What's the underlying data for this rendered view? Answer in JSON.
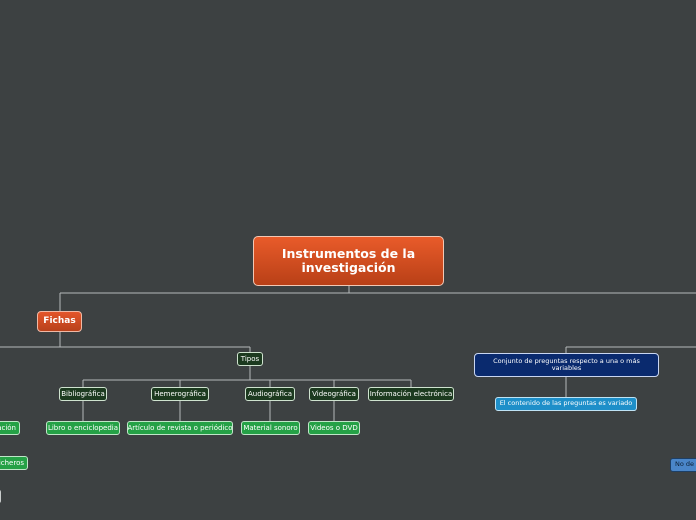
{
  "root": {
    "title": "Instrumentos de la investigación"
  },
  "fichas": {
    "label": "Fichas"
  },
  "tipos": {
    "label": "Tipos"
  },
  "categories": [
    {
      "label": "Bibliográfica",
      "example": "Libro o enciclopedia"
    },
    {
      "label": "Hemerográfica",
      "example": "Artículo de revista o periódico"
    },
    {
      "label": "Audiográfica",
      "example": "Material sonoro"
    },
    {
      "label": "Videográfica",
      "example": "Videos o DVD"
    },
    {
      "label": "Información electrónica"
    }
  ],
  "left_partial": [
    "ación",
    "ficheros"
  ],
  "cuestionario": {
    "definition": "Conjunto de preguntas respecto a una o más variables",
    "detail": "El contenido de las preguntas es variado"
  },
  "right_partial": "No de",
  "colors": {
    "background": "#3d4142",
    "root": "#d24e22",
    "type_node": "#1c3a1f",
    "example_node": "#25a146",
    "definition_node": "#0a2a6e",
    "detail_node": "#1e8fc9",
    "connector": "#b5b9ba"
  }
}
